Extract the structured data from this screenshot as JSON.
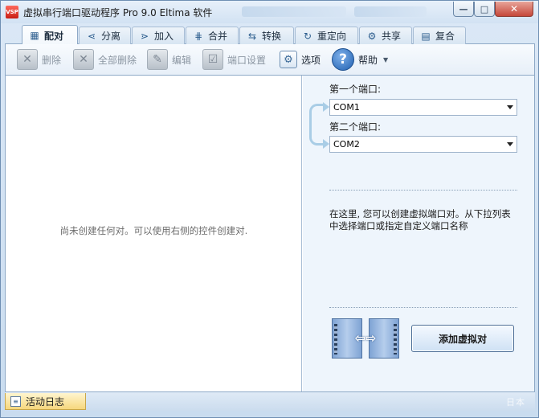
{
  "window": {
    "title": "虚拟串行端口驱动程序 Pro 9.0 Eltima 软件",
    "app_icon": "app-icon",
    "buttons": {
      "minimize": "—",
      "maximize": "□",
      "close": "✕"
    }
  },
  "tabs": [
    {
      "label": "配对",
      "icon": "pair-icon",
      "active": true
    },
    {
      "label": "分离",
      "icon": "split-icon"
    },
    {
      "label": "加入",
      "icon": "join-icon"
    },
    {
      "label": "合并",
      "icon": "merge-icon"
    },
    {
      "label": "转换",
      "icon": "convert-icon"
    },
    {
      "label": "重定向",
      "icon": "redirect-icon"
    },
    {
      "label": "共享",
      "icon": "share-icon"
    },
    {
      "label": "复合",
      "icon": "composite-icon"
    }
  ],
  "toolbar": {
    "delete_label": "删除",
    "delete_all_label": "全部删除",
    "edit_label": "编辑",
    "port_settings_label": "端口设置",
    "options_label": "选项",
    "help_label": "帮助"
  },
  "main": {
    "empty_message": "尚未创建任何对。可以使用右侧的控件创建对."
  },
  "pair_panel": {
    "first_port_label": "第一个端口:",
    "first_port_value": "COM1",
    "second_port_label": "第二个端口:",
    "second_port_value": "COM2",
    "hint": "在这里, 您可以创建虚拟端口对。从下拉列表中选择端口或指定自定义端口名称",
    "create_button": "添加虚拟对"
  },
  "statusbar": {
    "activity_log_label": "活动日志",
    "watermark": "日本"
  },
  "colors": {
    "accent": "#4d6f97",
    "window_bg": "#d3e3f3",
    "panel_bg": "#eef5fc",
    "log_tab": "#f6d77e"
  }
}
